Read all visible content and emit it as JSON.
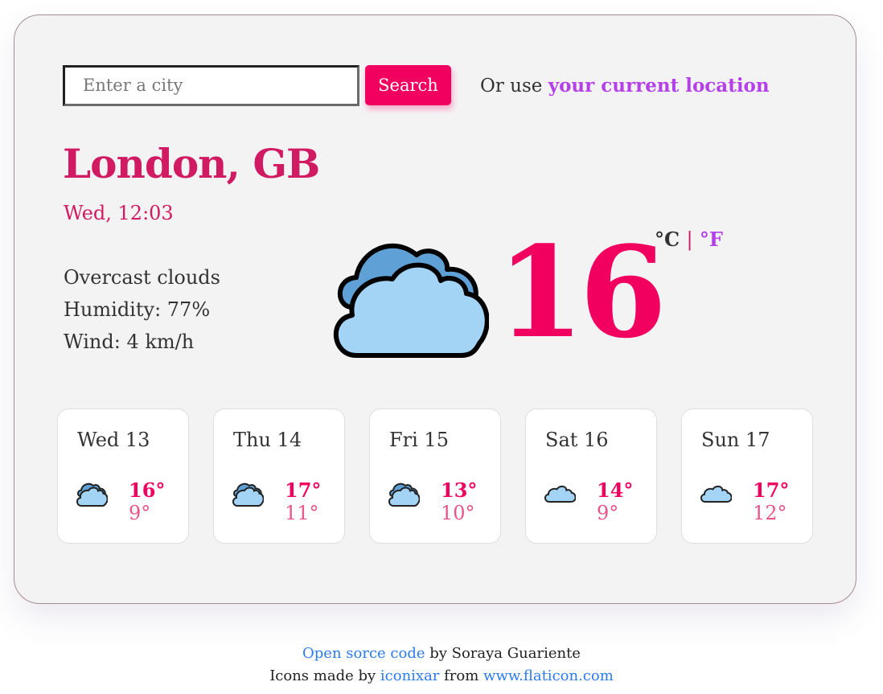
{
  "search": {
    "placeholder": "Enter a city",
    "value": "",
    "button_label": "Search",
    "or_use_text": "Or use",
    "location_link": "your current location"
  },
  "current": {
    "city": "London, GB",
    "datetime": "Wed, 12:03",
    "description": "Overcast clouds",
    "humidity": "Humidity: 77%",
    "wind": "Wind: 4 km/h",
    "icon": "overcast-clouds-icon",
    "temperature": "16",
    "unit_celsius": "°C",
    "unit_separator": "|",
    "unit_fahrenheit": "°F"
  },
  "forecast": [
    {
      "day": "Wed 13",
      "icon": "overcast-clouds-icon",
      "max": "16°",
      "min": "9°"
    },
    {
      "day": "Thu 14",
      "icon": "overcast-clouds-icon",
      "max": "17°",
      "min": "11°"
    },
    {
      "day": "Fri 15",
      "icon": "overcast-clouds-icon",
      "max": "13°",
      "min": "10°"
    },
    {
      "day": "Sat 16",
      "icon": "cloud-icon",
      "max": "14°",
      "min": "9°"
    },
    {
      "day": "Sun 17",
      "icon": "cloud-icon",
      "max": "17°",
      "min": "12°"
    }
  ],
  "footer": {
    "source_link": "Open sorce code",
    "by_text": " by Soraya Guariente",
    "icons_text": "Icons made by ",
    "author_link": "iconixar",
    "from_text": " from ",
    "site_link": "www.flaticon.com"
  },
  "colors": {
    "accent": "#f20060",
    "city": "#d01b63",
    "link_purple": "#b440e8",
    "link_blue": "#2b7bf0",
    "cloud_light": "#a3d3f5",
    "cloud_dark": "#5fa1d6"
  }
}
